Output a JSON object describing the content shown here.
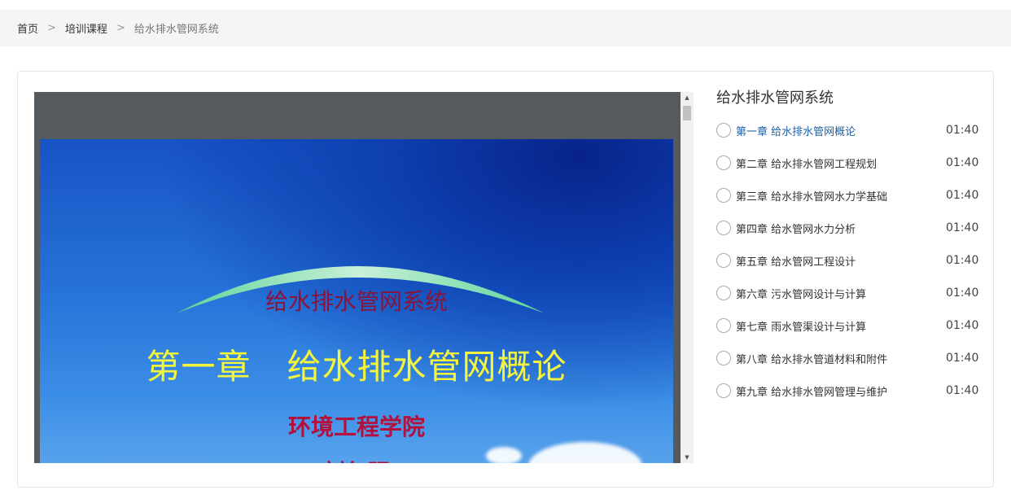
{
  "breadcrumb": {
    "home": "首页",
    "separator": ">",
    "category": "培训课程",
    "current": "给水排水管网系统"
  },
  "slide": {
    "subtitle": "给水排水管网系统",
    "chapter_prefix": "第一章",
    "chapter_title": "给水排水管网概论",
    "school": "环境工程学院",
    "author": "刘仁强"
  },
  "course": {
    "title": "给水排水管网系统",
    "chapters": [
      {
        "label": "第一章 给水排水管网概论",
        "duration": "01:40"
      },
      {
        "label": "第二章 给水排水管网工程规划",
        "duration": "01:40"
      },
      {
        "label": "第三章 给水排水管网水力学基础",
        "duration": "01:40"
      },
      {
        "label": "第四章 给水管网水力分析",
        "duration": "01:40"
      },
      {
        "label": "第五章 给水管网工程设计",
        "duration": "01:40"
      },
      {
        "label": "第六章 污水管网设计与计算",
        "duration": "01:40"
      },
      {
        "label": "第七章 雨水管渠设计与计算",
        "duration": "01:40"
      },
      {
        "label": "第八章 给水排水管道材料和附件",
        "duration": "01:40"
      },
      {
        "label": "第九章 给水排水管网管理与维护",
        "duration": "01:40"
      }
    ]
  },
  "colors": {
    "active_chapter": "#1f5fa6",
    "slide_title": "#f5f53a",
    "slide_subtitle": "#8a1438"
  },
  "icons": {
    "scroll_up": "triangle-up-icon",
    "scroll_down": "triangle-down-icon",
    "chapter_status": "radio-circle-icon"
  }
}
